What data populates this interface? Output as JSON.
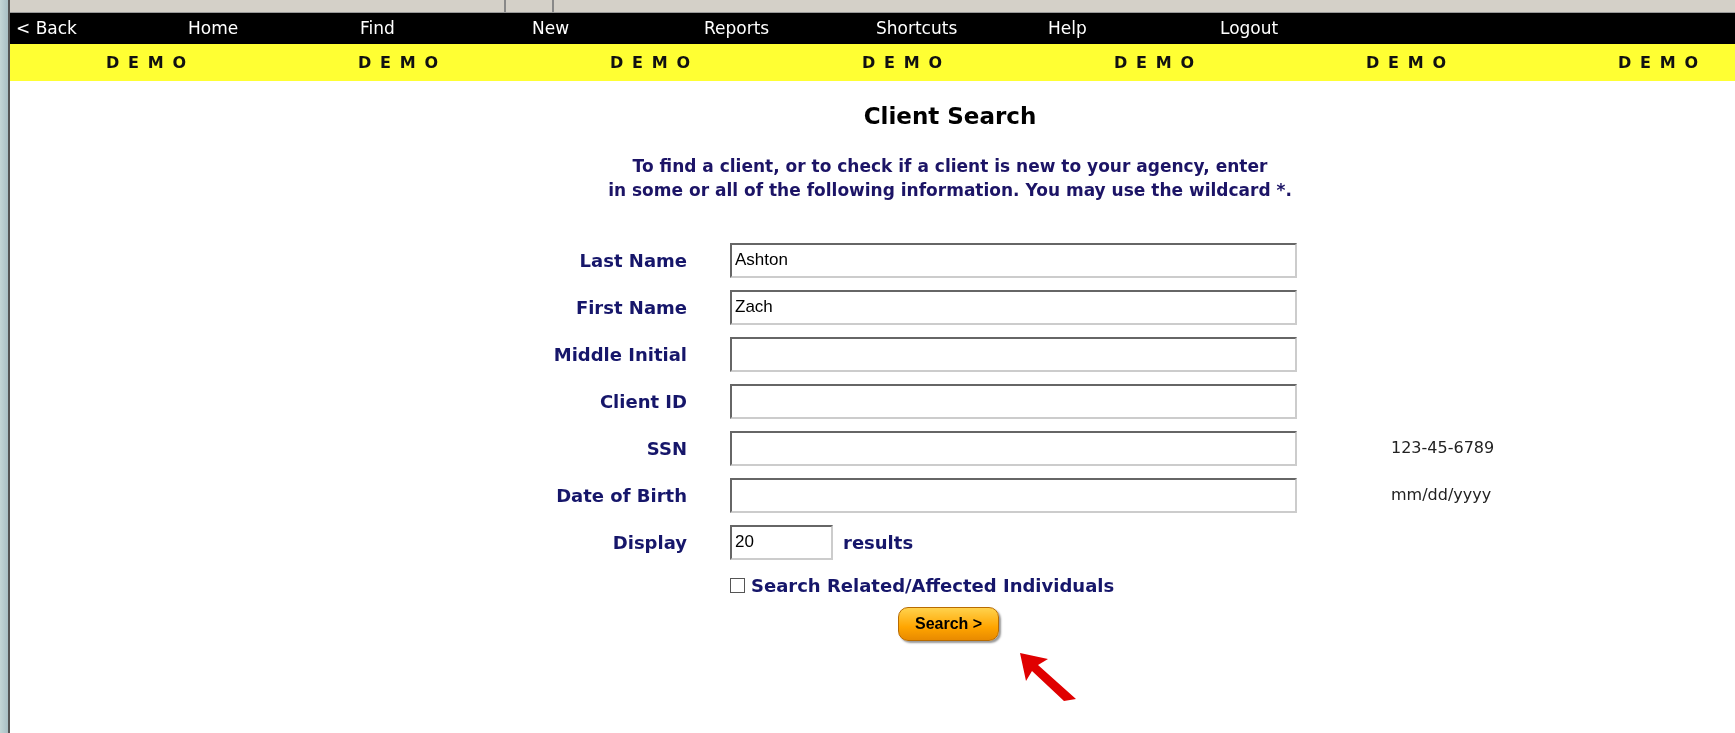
{
  "nav": [
    {
      "label": "< Back"
    },
    {
      "label": "Home"
    },
    {
      "label": "Find"
    },
    {
      "label": "New"
    },
    {
      "label": "Reports"
    },
    {
      "label": "Shortcuts"
    },
    {
      "label": "Help"
    },
    {
      "label": "Logout"
    }
  ],
  "banner": [
    "DEMO",
    "DEMO",
    "DEMO",
    "DEMO",
    "DEMO",
    "DEMO",
    "DEMO"
  ],
  "title": "Client Search",
  "instructions": [
    "To find a client, or to check if a client is new to your agency, enter",
    "in some or all of the following information. You may use the wildcard *."
  ],
  "fields": [
    {
      "label": "Last Name",
      "value": "Ashton"
    },
    {
      "label": "First Name",
      "value": "Zach"
    },
    {
      "label": "Middle Initial"
    },
    {
      "label": "Client ID"
    },
    {
      "label": "SSN",
      "hint": "123-45-6789"
    },
    {
      "label": "Date of Birth",
      "hint": "mm/dd/yyyy"
    }
  ],
  "display": {
    "label": "Display",
    "value": "20",
    "suffix": "results"
  },
  "related": {
    "label": "Search Related/Affected Individuals",
    "checked": false
  },
  "search_button": "Search >"
}
